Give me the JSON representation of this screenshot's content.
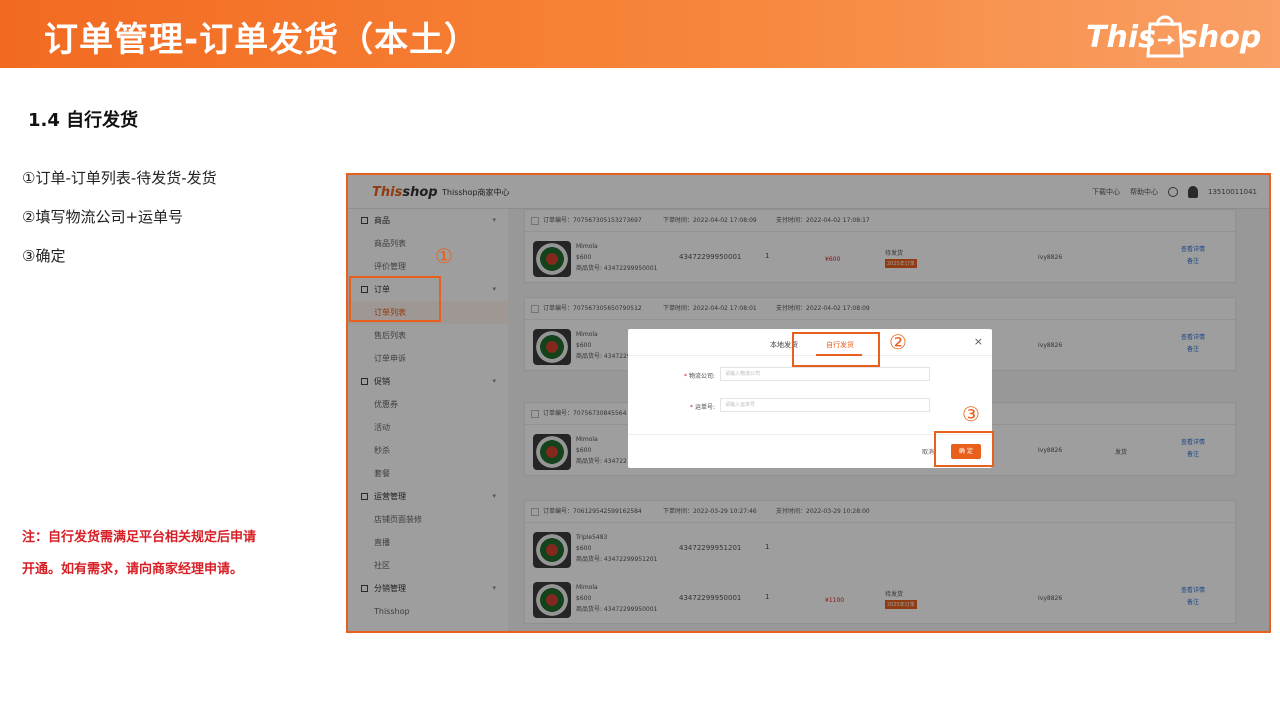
{
  "slide": {
    "title": "订单管理-订单发货（本土）",
    "brand": {
      "this": "This",
      "shop": "shop"
    },
    "section_heading": "1.4 自行发货",
    "steps": [
      "①订单-订单列表-待发货-发货",
      "②填写物流公司+运单号",
      "③确定"
    ],
    "note": [
      "注：自行发货需满足平台相关规定后申请",
      "开通。如有需求，请向商家经理申请。"
    ],
    "accent_color": "#e8601c",
    "note_color": "#d71f26"
  },
  "screenshot": {
    "topbar": {
      "logo_a": "This",
      "logo_b": "shop",
      "center": "Thisshop商家中心",
      "right": [
        "下载中心",
        "帮助中心"
      ],
      "account": "13510011041"
    },
    "sidebar": [
      {
        "label": "商品",
        "type": "group"
      },
      {
        "label": "商品列表",
        "type": "sub"
      },
      {
        "label": "评价管理",
        "type": "sub"
      },
      {
        "label": "订单",
        "type": "group"
      },
      {
        "label": "订单列表",
        "type": "sub",
        "active": true
      },
      {
        "label": "售后列表",
        "type": "sub"
      },
      {
        "label": "订单申诉",
        "type": "sub"
      },
      {
        "label": "促销",
        "type": "group"
      },
      {
        "label": "优惠券",
        "type": "sub"
      },
      {
        "label": "活动",
        "type": "sub"
      },
      {
        "label": "秒杀",
        "type": "sub"
      },
      {
        "label": "套餐",
        "type": "sub"
      },
      {
        "label": "运营管理",
        "type": "group"
      },
      {
        "label": "店铺页面装修",
        "type": "sub"
      },
      {
        "label": "直播",
        "type": "sub"
      },
      {
        "label": "社区",
        "type": "sub"
      },
      {
        "label": "分销管理",
        "type": "group"
      },
      {
        "label": "Thisshop",
        "type": "sub"
      }
    ],
    "orders": [
      {
        "order_no": "订单编号：707567305153273697",
        "order_time": "下单时间：2022-04-02 17:08:09",
        "pay_time": "支付时间：2022-04-02 17:08:17",
        "products": [
          {
            "name": "Mimola",
            "spec": "$600",
            "code": "商品货号: 43472299950001",
            "sku": "43472299950001",
            "qty": "1",
            "price": "¥600",
            "status": "待发货",
            "tag": "2025年订单",
            "buyer": "Ivy8826",
            "actions": [
              "查看详情",
              "备注"
            ]
          }
        ]
      },
      {
        "order_no": "订单编号：707567305650790512",
        "order_time": "下单时间：2022-04-02 17:08:01",
        "pay_time": "支付时间：2022-04-02 17:08:09",
        "products": [
          {
            "name": "Mimola",
            "spec": "$600",
            "code": "商品货号: 43472299950001",
            "sku": "",
            "qty": "",
            "price": "",
            "status": "",
            "tag": "",
            "buyer": "Ivy8826",
            "actions": [
              "查看详情",
              "备注"
            ]
          }
        ]
      },
      {
        "order_no": "订单编号：70756730845564",
        "order_time": "",
        "pay_time": "",
        "products": [
          {
            "name": "Mimola",
            "spec": "$600",
            "code": "商品货号: 434722",
            "sku": "",
            "qty": "",
            "price": "",
            "status": "",
            "tag": "",
            "buyer": "Ivy8826",
            "extra": "发货",
            "actions": [
              "查看详情",
              "备注"
            ]
          }
        ]
      },
      {
        "order_no": "订单编号：706129542599162584",
        "order_time": "下单时间：2022-03-29 10:27:46",
        "pay_time": "支付时间：2022-03-29 10:28:00",
        "products": [
          {
            "name": "Triple5483",
            "spec": "$600",
            "code": "商品货号: 43472299951201",
            "sku": "43472299951201",
            "qty": "1",
            "price": "",
            "status": "",
            "tag": "",
            "buyer": "",
            "actions": []
          },
          {
            "name": "Mimola",
            "spec": "$600",
            "code": "商品货号: 43472299950001",
            "sku": "43472299950001",
            "qty": "1",
            "price": "¥1100",
            "status": "待发货",
            "tag": "2025年订单",
            "buyer": "Ivy8826",
            "actions": [
              "查看详情",
              "备注"
            ]
          }
        ]
      }
    ],
    "modal": {
      "tabs": [
        "本地发货",
        "自行发货"
      ],
      "active_tab": 1,
      "close": "×",
      "fields": [
        {
          "label": "物流公司:",
          "placeholder": "请输入物流公司"
        },
        {
          "label": "运单号:",
          "placeholder": "请输入运单号"
        }
      ],
      "cancel": "取消",
      "ok": "确 定"
    },
    "badges": [
      "①",
      "②",
      "③"
    ]
  }
}
